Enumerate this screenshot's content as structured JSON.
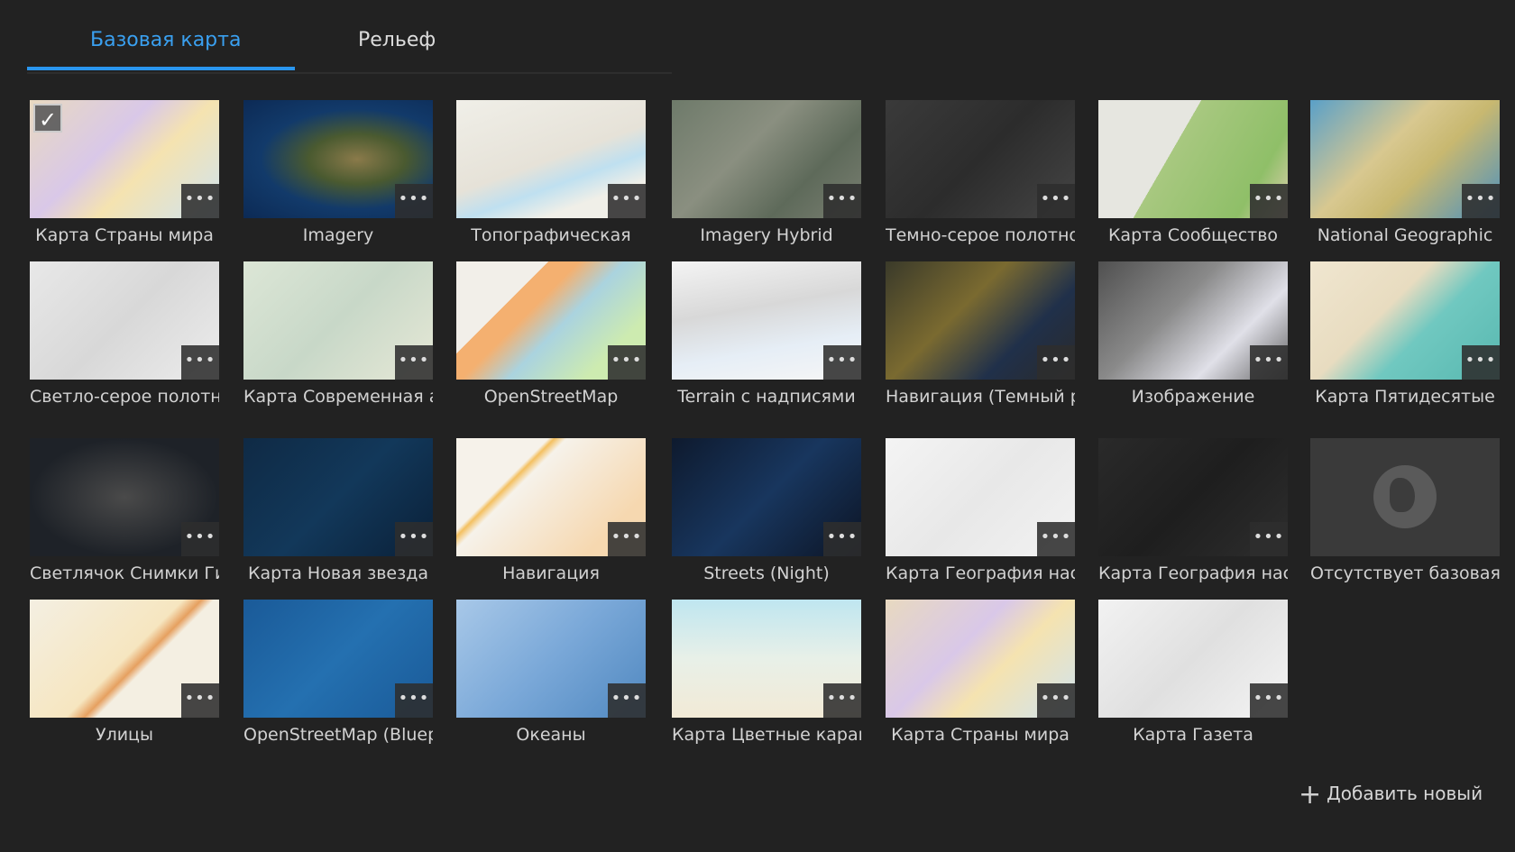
{
  "tabs": [
    {
      "label": "Базовая карта",
      "active": true
    },
    {
      "label": "Рельеф",
      "active": false
    }
  ],
  "accent_color": "#2a96ee",
  "more_icon": "ellipsis-icon",
  "more_label": "•••",
  "check_label": "✓",
  "basemaps": [
    {
      "label": "Карта Страны мира",
      "bg": "linear-gradient(135deg,#e8d9c0,#d9c8e8 40%,#f5e3b0 60%,#cfe3f0)",
      "selected": true
    },
    {
      "label": "Imagery",
      "bg": "radial-gradient(ellipse at 60% 50%,#8a7a4a 0,#4a5a30 30%,#123a6a 60%,#0c2a55 100%)"
    },
    {
      "label": "Топографическая",
      "bg": "linear-gradient(160deg,#f0efe8,#e6e2d8 50%,#bfe0f0 65%,#f0efe8 80%)"
    },
    {
      "label": "Imagery Hybrid",
      "bg": "linear-gradient(135deg,#6e7a6a,#8a8f80 40%,#5e6a5a 70%,#7a7f72)"
    },
    {
      "label": "Темно-серое полотно",
      "bg": "linear-gradient(135deg,#3a3a3a,#2c2c2c 50%,#454545)"
    },
    {
      "label": "Карта Сообщество",
      "bg": "linear-gradient(120deg,#e6e6e0 0,#e6e6e0 40%,#a8c880 40%,#8fbf68 80%,#e0d0b0 100%)"
    },
    {
      "label": "National Geographic",
      "bg": "linear-gradient(135deg,#5aa0c8,#d8c890 40%,#c8b870 60%,#4a90c0)"
    },
    {
      "label": "Светло-серое полотно",
      "bg": "linear-gradient(135deg,#e8e8e8,#d8d8d8 50%,#ececec)"
    },
    {
      "label": "Карта Современная античная",
      "bg": "linear-gradient(135deg,#dce6d6,#c8d8c8 50%,#e6e8d6)"
    },
    {
      "label": "OpenStreetMap",
      "bg": "linear-gradient(135deg,#f2efe9 0,#f2efe9 30%,#f4b070 30%,#f4b070 40%,#aad3df 55%,#cdebb0 80%)"
    },
    {
      "label": "Terrain с надписями",
      "bg": "linear-gradient(170deg,#f4f4f4,#d8d8d8 40%,#e6eef6 70%,#f6f6f6)"
    },
    {
      "label": "Навигация (Темный режим)",
      "bg": "linear-gradient(135deg,#3a3a2a,#7a6a30 40%,#20304a 70%,#2a2a2a)"
    },
    {
      "label": "Изображение",
      "bg": "linear-gradient(135deg,#505050,#8a8a8a 40%,#e0e0e8 70%,#606060)"
    },
    {
      "label": "Карта Пятидесятые",
      "bg": "linear-gradient(135deg,#f0e6d0,#e8dcc0 40%,#70c8c0 60%,#58b8b0)"
    },
    {
      "label": "Светлячок Снимки Гибрид",
      "bg": "radial-gradient(ellipse at 50% 50%,#4a4a4a,#1e2228 70%)"
    },
    {
      "label": "Карта Новая звезда",
      "bg": "linear-gradient(135deg,#0f2a45,#12385a 50%,#0a2038)"
    },
    {
      "label": "Навигация",
      "bg": "linear-gradient(135deg,#f6f2ea 0,#f6f2ea 30%,#f4c060 32%,#f6f2ea 36%,#f6d8b0 80%)"
    },
    {
      "label": "Streets (Night)",
      "bg": "linear-gradient(135deg,#0e1a2e,#18365e 50%,#0c1424)"
    },
    {
      "label": "Карта География населения",
      "bg": "linear-gradient(135deg,#f4f4f4,#e8e8e8 50%,#f2f2f2)"
    },
    {
      "label": "Карта География населения (темная)",
      "bg": "linear-gradient(135deg,#2a2a2a,#1e1e1e 50%,#2e2e2e)"
    },
    {
      "label": "Отсутствует базовая карта",
      "bg": "#3a3a3a",
      "empty": true
    },
    {
      "label": "Улицы",
      "bg": "linear-gradient(135deg,#f4efe2,#f6e6c0 50%,#e6a060 56%,#f4efe2 60%)"
    },
    {
      "label": "OpenStreetMap (Blueprint)",
      "bg": "linear-gradient(135deg,#1a5a98,#2470b0 50%,#1a5a98)"
    },
    {
      "label": "Океаны",
      "bg": "linear-gradient(135deg,#a8c8e8,#7aa8d8 50%,#5088c0)"
    },
    {
      "label": "Карта Цветные карандаши",
      "bg": "linear-gradient(180deg,#bfe6f0,#e8f0e8 50%,#f2ead6)"
    },
    {
      "label": "Карта Страны мира",
      "bg": "linear-gradient(135deg,#e8d9c0,#d9c8e8 40%,#f5e3b0 60%,#cfe3f0)"
    },
    {
      "label": "Карта Газета",
      "bg": "linear-gradient(135deg,#f2f2f2,#e0e0e0 50%,#f4f4f4)"
    }
  ],
  "add_new": {
    "icon": "plus-icon",
    "label": "Добавить новый"
  }
}
